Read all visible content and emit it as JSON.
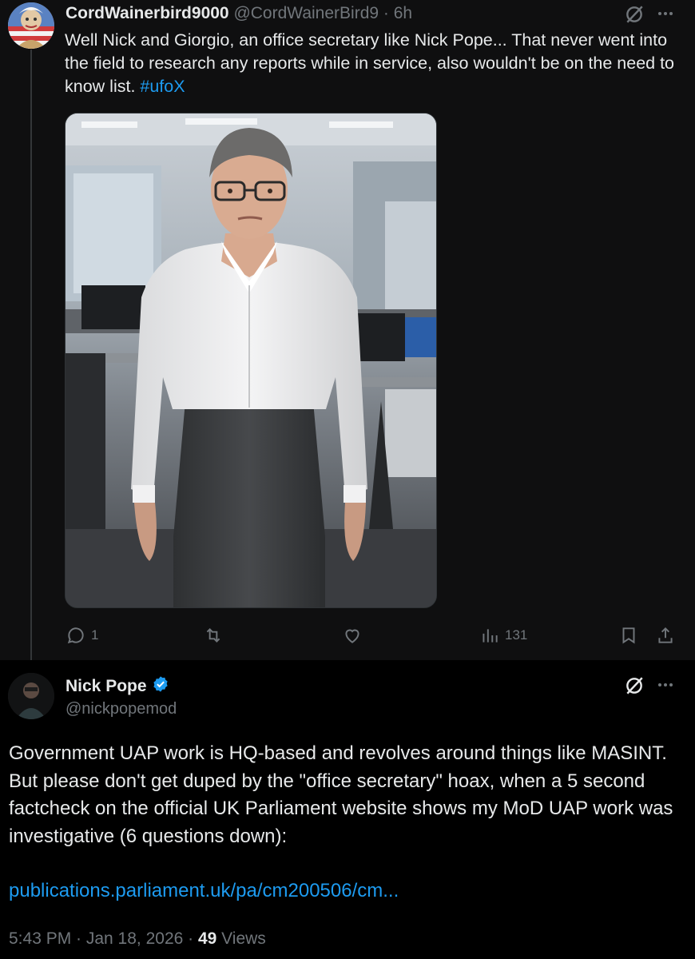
{
  "reply": {
    "display_name": "CordWainerbird9000",
    "handle_time": "@CordWainerBird9 · 6h",
    "text_before": "Well Nick and Giorgio, an office secretary like Nick Pope... That never went into the field to research any reports while in service, also wouldn't be on the need to know list. ",
    "hashtag": "#ufoX",
    "media_icon": "photo-office-man",
    "actions": {
      "reply_count": "1",
      "retweet_count": "",
      "like_count": "",
      "views_count": "131"
    }
  },
  "main": {
    "display_name": "Nick Pope",
    "verified_icon": "verified-badge-icon",
    "handle": "@nickpopemod",
    "text": "Government UAP work is HQ-based and revolves around things like MASINT. But please don't get duped by the \"office secretary\" hoax, when a 5 second factcheck on the official UK Parliament website shows my MoD UAP work was investigative (6 questions down):",
    "link": "publications.parliament.uk/pa/cm200506/cm...",
    "time": "5:43 PM · Jan 18, 2026 · ",
    "views_count": "49",
    "views_label": " Views"
  },
  "colors": {
    "accent": "#1d9bf0",
    "muted": "#71767b",
    "text": "#e7e9ea",
    "background": "#000000"
  }
}
